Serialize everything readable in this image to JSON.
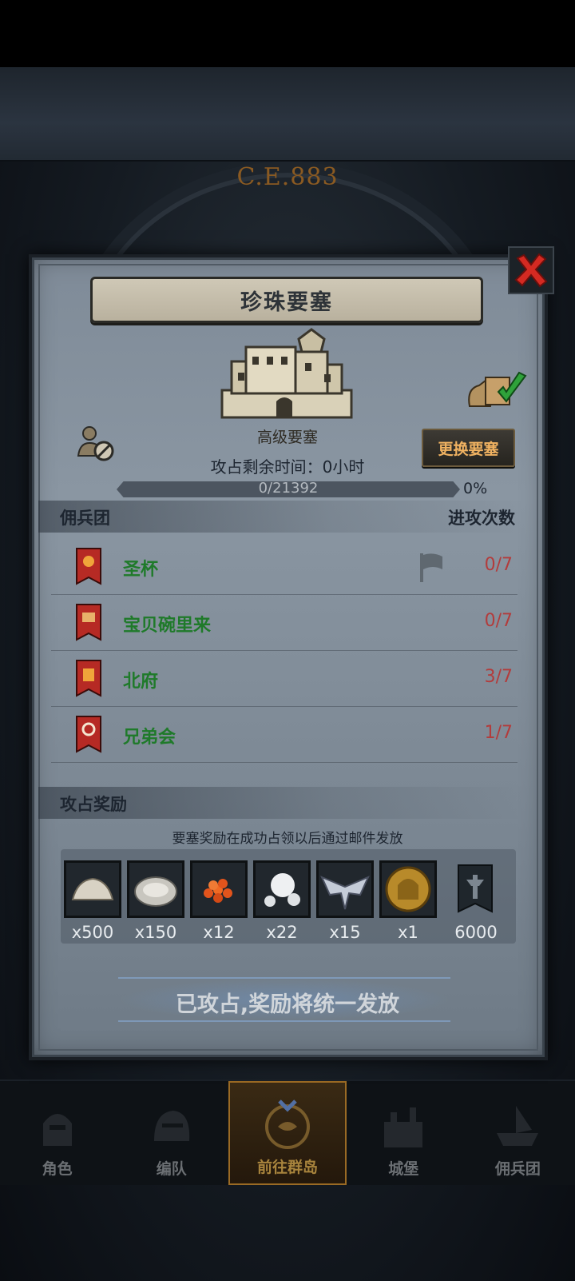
{
  "background": {
    "era": "C.E.883"
  },
  "dialog": {
    "title": "珍珠要塞",
    "fort_grade": "高级要塞",
    "change_button": "更换要塞",
    "capture_timer": "攻占剩余时间：0小时",
    "progress": {
      "text": "0/21392",
      "percent_text": "0%",
      "fraction": 0.0
    },
    "mercenary_header": {
      "left": "佣兵团",
      "right": "进攻次数"
    },
    "guilds": [
      {
        "name": "圣杯",
        "attacks": "0/7",
        "banner_color": "#b62a24"
      },
      {
        "name": "宝贝碗里来",
        "attacks": "0/7",
        "banner_color": "#b62a24"
      },
      {
        "name": "北府",
        "attacks": "3/7",
        "banner_color": "#b62a24"
      },
      {
        "name": "兄弟会",
        "attacks": "1/7",
        "banner_color": "#b62a24"
      }
    ],
    "rewards_header": "攻占奖励",
    "rewards_note": "要塞奖励在成功占领以后通过邮件发放",
    "rewards": [
      {
        "icon": "flour-sack-icon",
        "qty": "x500"
      },
      {
        "icon": "oyster-icon",
        "qty": "x150"
      },
      {
        "icon": "caviar-icon",
        "qty": "x12"
      },
      {
        "icon": "pearl-icon",
        "qty": "x22"
      },
      {
        "icon": "wing-emblem-icon",
        "qty": "x15"
      },
      {
        "icon": "knight-medal-icon",
        "qty": "x1"
      },
      {
        "icon": "guild-banner-icon",
        "qty": "6000"
      }
    ],
    "status": "已攻占,奖励将统一发放"
  },
  "bottom_nav": [
    {
      "label": "角色",
      "active": false
    },
    {
      "label": "编队",
      "active": false
    },
    {
      "label": "前往群岛",
      "active": true
    },
    {
      "label": "城堡",
      "active": false
    },
    {
      "label": "佣兵团",
      "active": false
    }
  ],
  "colors": {
    "accent": "#f0b261",
    "guild_name": "#1f7a2a",
    "attack_count": "#b23c3c"
  }
}
